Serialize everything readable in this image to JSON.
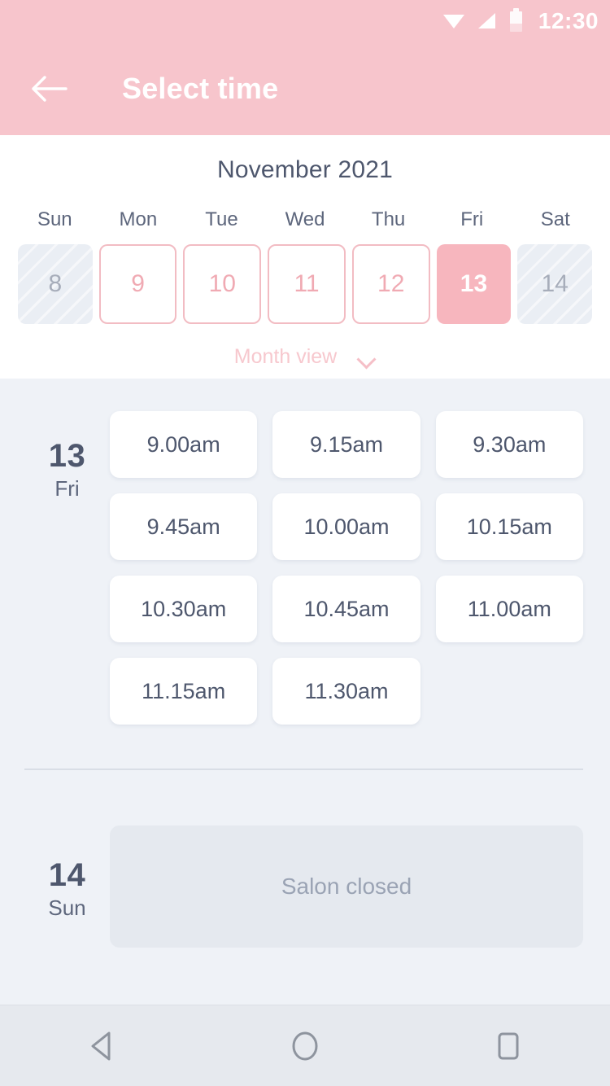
{
  "status_bar": {
    "time": "12:30",
    "icons": [
      "wifi-icon",
      "signal-icon",
      "battery-icon"
    ]
  },
  "app_bar": {
    "back_icon": "back-arrow-icon",
    "title": "Select time"
  },
  "calendar": {
    "month_title": "November 2021",
    "weekdays": [
      "Sun",
      "Mon",
      "Tue",
      "Wed",
      "Thu",
      "Fri",
      "Sat"
    ],
    "days": [
      {
        "number": "8",
        "state": "disabled"
      },
      {
        "number": "9",
        "state": "available"
      },
      {
        "number": "10",
        "state": "available"
      },
      {
        "number": "11",
        "state": "available"
      },
      {
        "number": "12",
        "state": "available"
      },
      {
        "number": "13",
        "state": "selected"
      },
      {
        "number": "14",
        "state": "disabled"
      }
    ],
    "view_toggle": {
      "label": "Month view",
      "icon": "chevron-down-icon"
    }
  },
  "schedule": [
    {
      "day_number": "13",
      "weekday": "Fri",
      "slots": [
        "9.00am",
        "9.15am",
        "9.30am",
        "9.45am",
        "10.00am",
        "10.15am",
        "10.30am",
        "10.45am",
        "11.00am",
        "11.15am",
        "11.30am"
      ]
    },
    {
      "day_number": "14",
      "weekday": "Sun",
      "closed_message": "Salon closed"
    }
  ],
  "nav_bar": {
    "back": "nav-back-icon",
    "home": "nav-home-icon",
    "recents": "nav-recents-icon"
  },
  "colors": {
    "accent_pink": "#f7c5cc",
    "selected_pink": "#f7b6be",
    "body_bg": "#eff2f7",
    "text_dark": "#4e576d",
    "text_muted": "#9aa3b4"
  }
}
